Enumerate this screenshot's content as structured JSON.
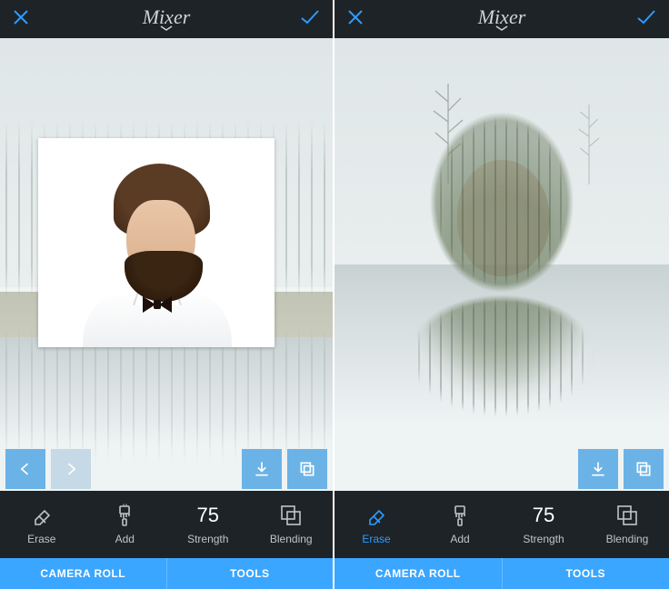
{
  "header": {
    "title": "Mixer"
  },
  "tools": {
    "erase": {
      "label": "Erase"
    },
    "add": {
      "label": "Add"
    },
    "strength": {
      "label": "Strength",
      "value": "75"
    },
    "blending": {
      "label": "Blending"
    }
  },
  "tabs": {
    "camera_roll": "CAMERA ROLL",
    "tools": "TOOLS"
  },
  "screens": {
    "left": {
      "erase_active": false
    },
    "right": {
      "erase_active": true
    }
  }
}
